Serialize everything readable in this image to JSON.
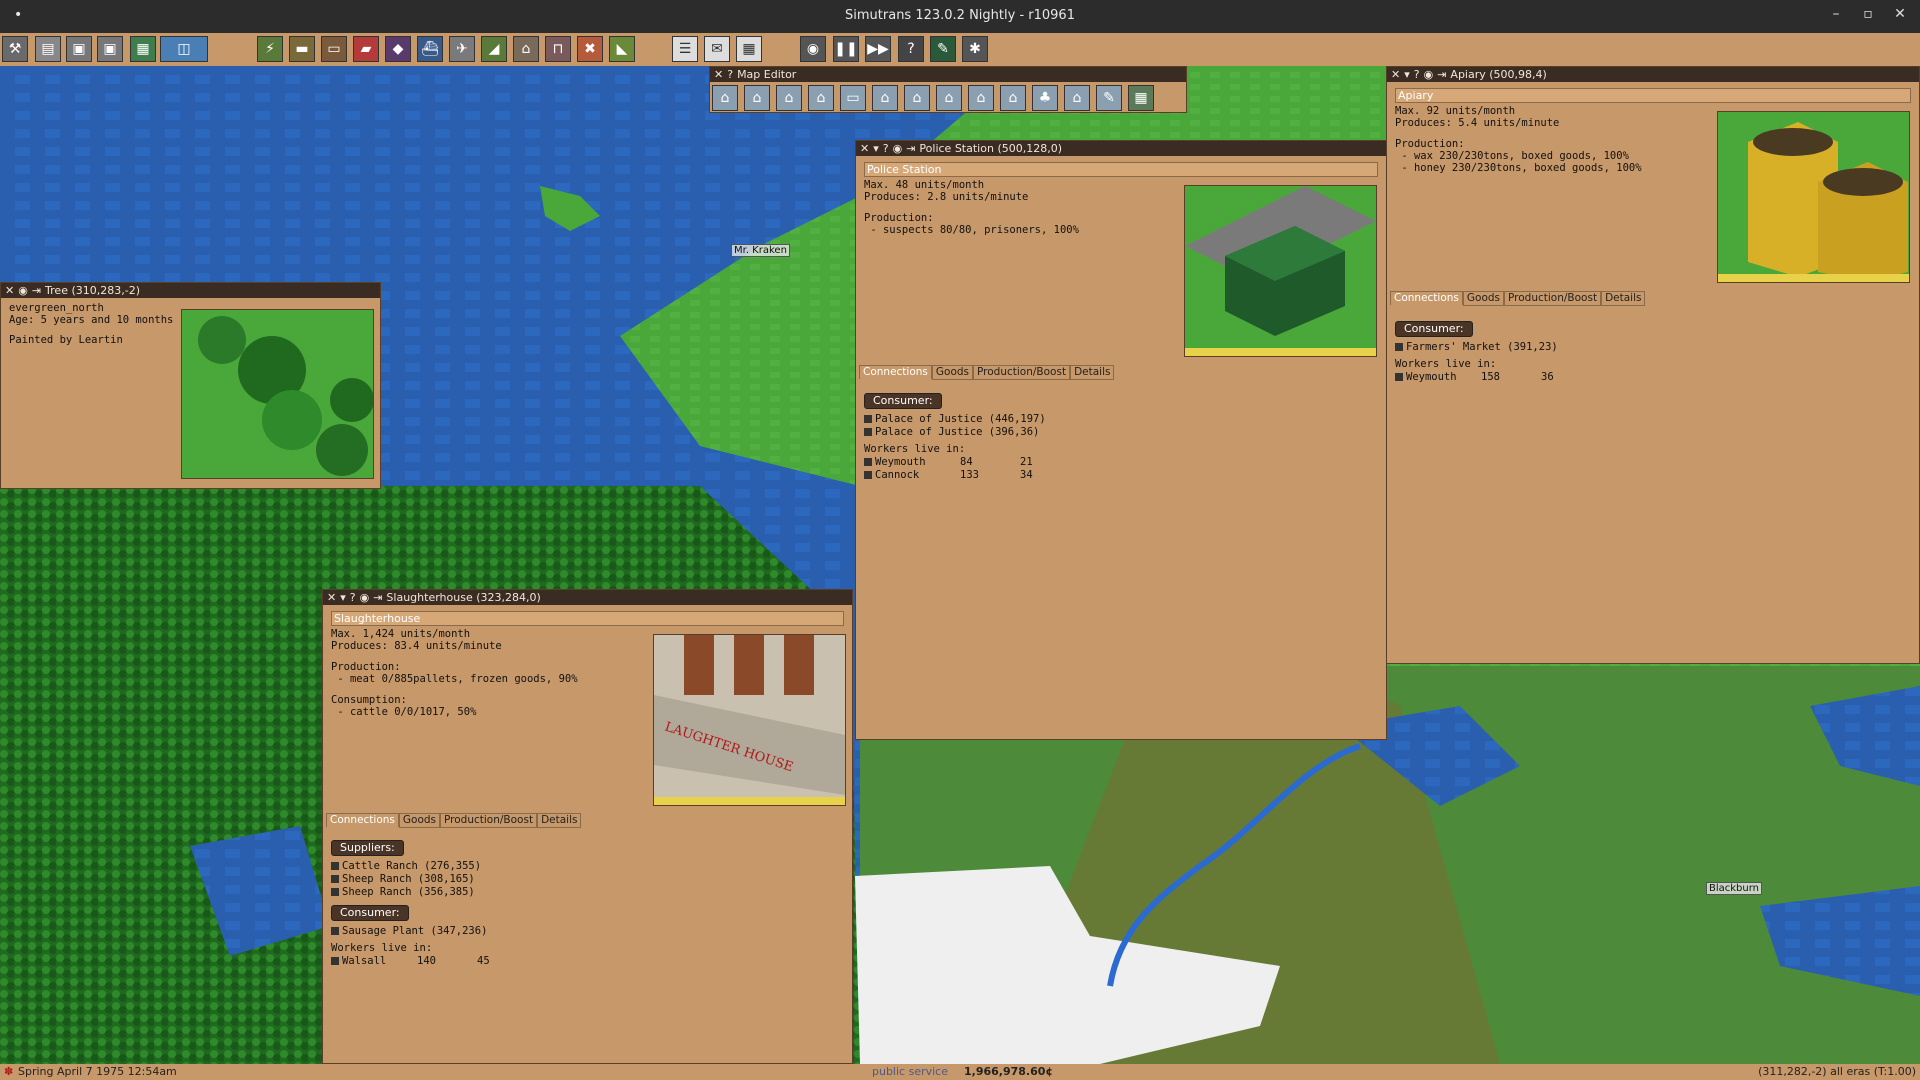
{
  "window": {
    "title": "Simutrans 123.0.2 Nightly - r10961"
  },
  "map_labels": {
    "kraken": "Mr. Kraken",
    "town": "Blackburn"
  },
  "map_editor": {
    "title": "Map Editor"
  },
  "tree": {
    "title": "Tree",
    "coords": "(310,283,-2)",
    "name": "evergreen_north",
    "age": "Age: 5 years and 10 months",
    "painter": "Painted by Leartin"
  },
  "police": {
    "title": "Police Station",
    "coords": "(500,128,0)",
    "name": "Police Station",
    "max": "Max. 48 units/month",
    "produces": "Produces: 2.8 units/minute",
    "production_header": "Production:",
    "production_line": " - suspects 80/80, prisoners, 100%",
    "tabs": [
      "Connections",
      "Goods",
      "Production/Boost",
      "Details"
    ],
    "consumer_label": "Consumer:",
    "consumers": [
      "Palace of Justice (446,197)",
      "Palace of Justice (396,36)"
    ],
    "workers_label": "Workers live in:",
    "workers": [
      {
        "town": "Weymouth",
        "a": "84",
        "b": "21"
      },
      {
        "town": "Cannock",
        "a": "133",
        "b": "34"
      }
    ]
  },
  "apiary": {
    "title": "Apiary",
    "coords": "(500,98,4)",
    "name": "Apiary",
    "max": "Max. 92 units/month",
    "produces": "Produces: 5.4 units/minute",
    "production_header": "Production:",
    "production_lines": [
      " - wax 230/230tons, boxed goods, 100%",
      " - honey 230/230tons, boxed goods, 100%"
    ],
    "tabs": [
      "Connections",
      "Goods",
      "Production/Boost",
      "Details"
    ],
    "consumer_label": "Consumer:",
    "consumers": [
      "Farmers' Market (391,23)"
    ],
    "workers_label": "Workers live in:",
    "workers": [
      {
        "town": "Weymouth",
        "a": "158",
        "b": "36"
      }
    ]
  },
  "slaughter": {
    "title": "Slaughterhouse",
    "coords": "(323,284,0)",
    "name": "Slaughterhouse",
    "max": "Max. 1,424 units/month",
    "produces": "Produces: 83.4 units/minute",
    "production_header": "Production:",
    "production_line": " - meat 0/885pallets, frozen goods, 90%",
    "consumption_header": "Consumption:",
    "consumption_line": " - cattle 0/0/1017, 50%",
    "image_text": "LAUGHTER HOUSE",
    "tabs": [
      "Connections",
      "Goods",
      "Production/Boost",
      "Details"
    ],
    "suppliers_label": "Suppliers:",
    "suppliers": [
      "Cattle Ranch (276,355)",
      "Sheep Ranch (308,165)",
      "Sheep Ranch (356,385)"
    ],
    "consumer_label": "Consumer:",
    "consumers": [
      "Sausage Plant (347,236)"
    ],
    "workers_label": "Workers live in:",
    "workers": [
      {
        "town": "Walsall",
        "a": "140",
        "b": "45"
      }
    ]
  },
  "status": {
    "date": "Spring April 7 1975 12:54am",
    "service": "public service",
    "money": "1,966,978.60¢",
    "coords": "(311,282,-2) all eras (T:1.00)"
  }
}
